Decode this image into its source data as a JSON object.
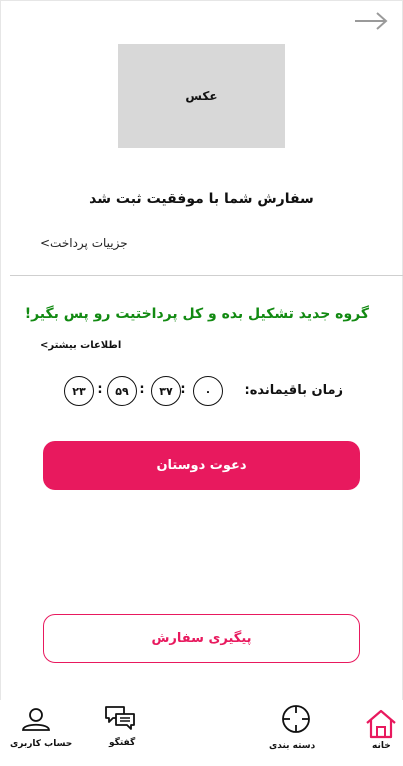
{
  "header": {
    "back_icon": "arrow-right-icon"
  },
  "order": {
    "photo_label": "عکس",
    "success_title": "سفارش شما با موفقیت ثبت شد",
    "payment_details_link": "جزییات پرداخت>"
  },
  "promo": {
    "headline": "گروه جدید تشکیل بده و کل پرداختیت رو پس بگیر!",
    "headline_color": "#128a12",
    "more_info_link": "اطلاعات بیشتر>"
  },
  "timer": {
    "label": "زمان باقیمانده:",
    "days": "۰",
    "hours": "۳۷",
    "minutes": "۵۹",
    "seconds": "۲۳",
    "separator": ":"
  },
  "actions": {
    "invite_label": "دعوت دوستان",
    "track_label": "پیگیری سفارش",
    "accent_color": "#e8195e"
  },
  "bottom_nav": {
    "items": [
      {
        "label": "حساب کاربری",
        "icon": "user-icon"
      },
      {
        "label": "گفتگو",
        "icon": "chat-icon"
      },
      {
        "label": "دسته بندی",
        "icon": "crosshair-icon"
      },
      {
        "label": "خانه",
        "icon": "home-icon",
        "active": true
      }
    ],
    "active_color": "#e8195e"
  }
}
